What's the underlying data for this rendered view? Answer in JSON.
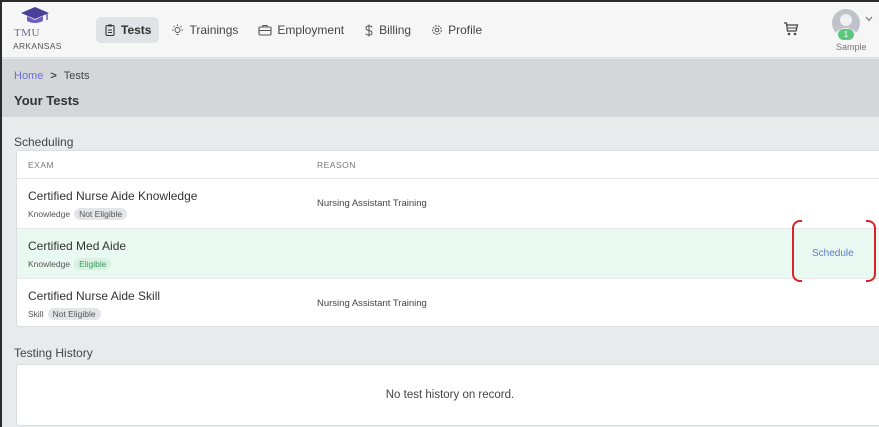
{
  "brand": {
    "name": "TMU",
    "state": "ARKANSAS"
  },
  "nav": {
    "items": [
      {
        "label": "Tests",
        "icon": "clipboard-icon",
        "active": true
      },
      {
        "label": "Trainings",
        "icon": "lightbulb-icon",
        "active": false
      },
      {
        "label": "Employment",
        "icon": "briefcase-icon",
        "active": false
      },
      {
        "label": "Billing",
        "icon": "dollar-icon",
        "active": false
      },
      {
        "label": "Profile",
        "icon": "gear-icon",
        "active": false
      }
    ]
  },
  "user": {
    "name": "Sample",
    "badge": "1"
  },
  "breadcrumb": {
    "home": "Home",
    "separator": ">",
    "current": "Tests"
  },
  "page": {
    "title": "Your Tests"
  },
  "scheduling": {
    "title": "Scheduling",
    "columns": {
      "exam": "EXAM",
      "reason": "REASON"
    },
    "rows": [
      {
        "exam": "Certified Nurse Aide Knowledge",
        "type": "Knowledge",
        "status": "Not Eligible",
        "reason": "Nursing Assistant Training",
        "action": ""
      },
      {
        "exam": "Certified Med Aide",
        "type": "Knowledge",
        "status": "Eligible",
        "reason": "",
        "action": "Schedule"
      },
      {
        "exam": "Certified Nurse Aide Skill",
        "type": "Skill",
        "status": "Not Eligible",
        "reason": "Nursing Assistant Training",
        "action": ""
      }
    ]
  },
  "history": {
    "title": "Testing History",
    "empty_message": "No test history on record."
  },
  "colors": {
    "accent_link": "#6b6fd6",
    "eligible": "#3a9c5c",
    "highlight_row": "#e9f8f0",
    "annotation": "#d9232a"
  }
}
